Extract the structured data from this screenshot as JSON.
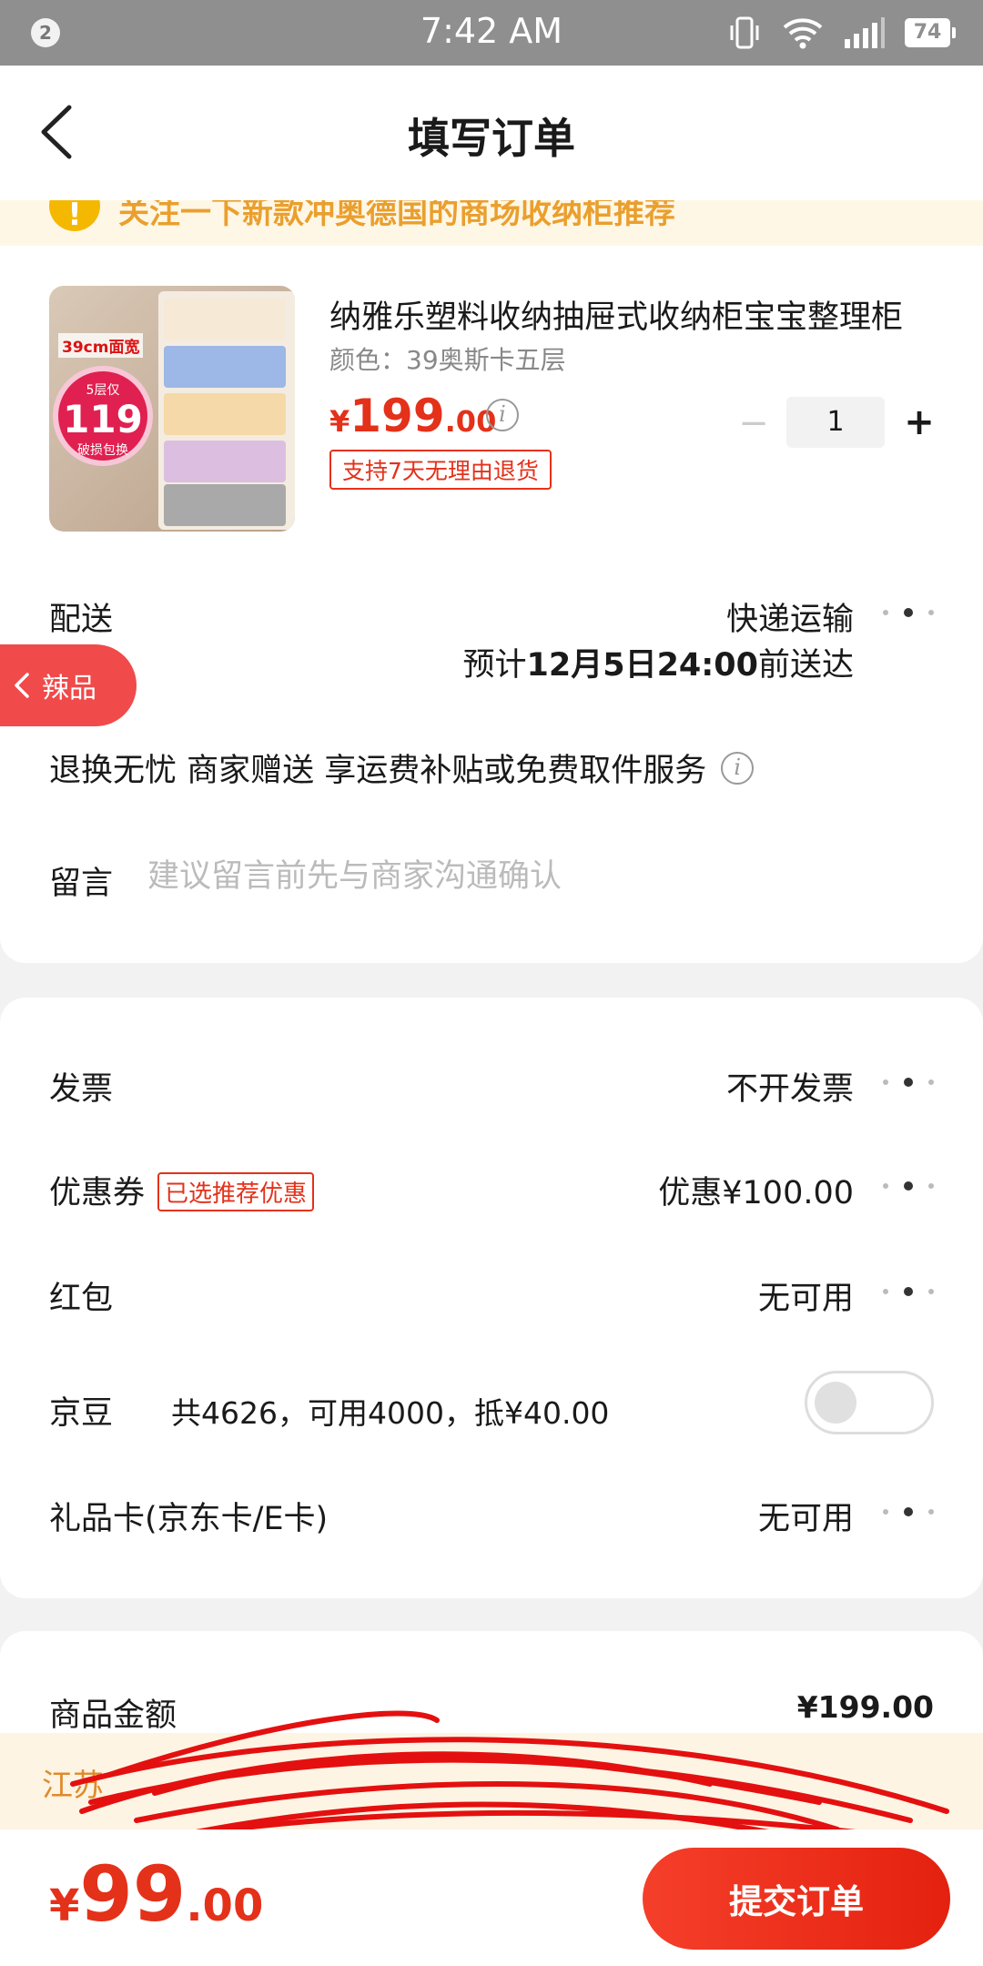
{
  "status_bar": {
    "notification_count": "2",
    "time": "7:42 AM",
    "battery": "74"
  },
  "header": {
    "title": "填写订单"
  },
  "notice": {
    "text": "关注一下新款冲奥德国的商场收纳柜推荐"
  },
  "product": {
    "title": "纳雅乐塑料收纳抽屉式收纳柜宝宝整理柜",
    "spec": "颜色：39奥斯卡五层",
    "price_symbol": "¥",
    "price_int": "199",
    "price_dec": ".00",
    "return_policy": "支持7天无理由退货",
    "quantity": "1",
    "image_tag": "39cm面宽",
    "image_badge_top": "5层仅",
    "image_badge_price": "119",
    "image_badge_bottom": "破损包换"
  },
  "delivery": {
    "label": "配送",
    "method": "快递运输",
    "eta_prefix": "预计",
    "eta_date": "12月5日24:00",
    "eta_suffix": "前送达"
  },
  "float_tab": {
    "label": "辣品"
  },
  "service": {
    "text": "退换无忧 商家赠送  享运费补贴或免费取件服务"
  },
  "message": {
    "label": "留言",
    "placeholder": "建议留言前先与商家沟通确认"
  },
  "invoice": {
    "label": "发票",
    "value": "不开发票"
  },
  "coupon": {
    "label": "优惠券",
    "tag": "已选推荐优惠",
    "value": "优惠¥100.00"
  },
  "red_packet": {
    "label": "红包",
    "value": "无可用"
  },
  "jd_beans": {
    "label": "京豆",
    "detail": "共4626，可用4000，抵¥40.00",
    "enabled": false
  },
  "gift_card": {
    "label": "礼品卡(京东卡/E卡)",
    "value": "无可用"
  },
  "summary": {
    "goods_amount_label": "商品金额",
    "goods_amount_value": "¥199.00"
  },
  "address_strip": {
    "text": "江苏"
  },
  "footer": {
    "price_symbol": "¥",
    "price_int": "99",
    "price_dec": ".00",
    "submit_label": "提交订单"
  },
  "colors": {
    "accent": "#e4311a",
    "notice": "#e58a00",
    "float_tab": "#f04a4a"
  }
}
